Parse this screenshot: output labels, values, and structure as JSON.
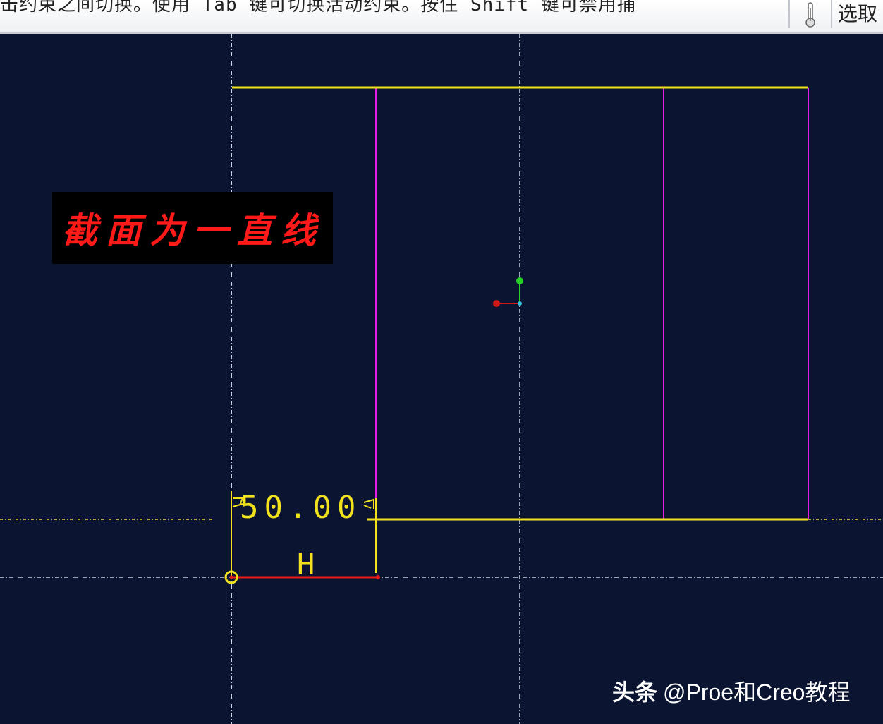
{
  "topbar": {
    "prompt": "击约束之间切换。使用 Tab 键可切换活动约束。按住 Shift 键可禁用捕",
    "select_button": "选取"
  },
  "sketch": {
    "dimension_value": "50.00",
    "constraint_label": "H"
  },
  "annotation": {
    "text": "截面为一直线"
  },
  "watermark": {
    "source": "头条",
    "handle": "@Proe和Creo教程"
  },
  "colors": {
    "background": "#0b1532",
    "sketch_line": "#f2e21e",
    "reference_line": "#e11de6",
    "constraint_line": "#e81a1a",
    "axis_green": "#22d122",
    "annotation_text": "#ff1a1a"
  },
  "icons": [
    "thermometer-icon",
    "coordinate-system-icon",
    "vertex-marker-icon"
  ]
}
